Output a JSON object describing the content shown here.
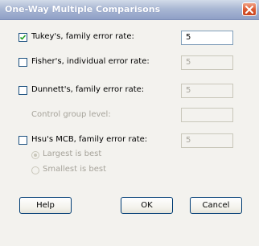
{
  "window": {
    "title": "One-Way Multiple Comparisons"
  },
  "options": [
    {
      "label": "Tukey's, family error rate:",
      "checked": true,
      "value": "5",
      "enabled": true
    },
    {
      "label": "Fisher's, individual error rate:",
      "checked": false,
      "value": "5",
      "enabled": false
    },
    {
      "label": "Dunnett's, family error rate:",
      "checked": false,
      "value": "5",
      "enabled": false
    },
    {
      "label": "Hsu's MCB, family error rate:",
      "checked": false,
      "value": "5",
      "enabled": false
    }
  ],
  "control_group": {
    "label": "Control group level:",
    "value": ""
  },
  "hsu_radios": [
    {
      "label": "Largest is best",
      "selected": true
    },
    {
      "label": "Smallest is best",
      "selected": false
    }
  ],
  "buttons": {
    "help": "Help",
    "ok": "OK",
    "cancel": "Cancel"
  },
  "colors": {
    "title_bar": "#aab8d4",
    "close_button": "#d9572e",
    "dialog_bg": "#f3f2ee",
    "disabled_text": "#a6a39a"
  }
}
